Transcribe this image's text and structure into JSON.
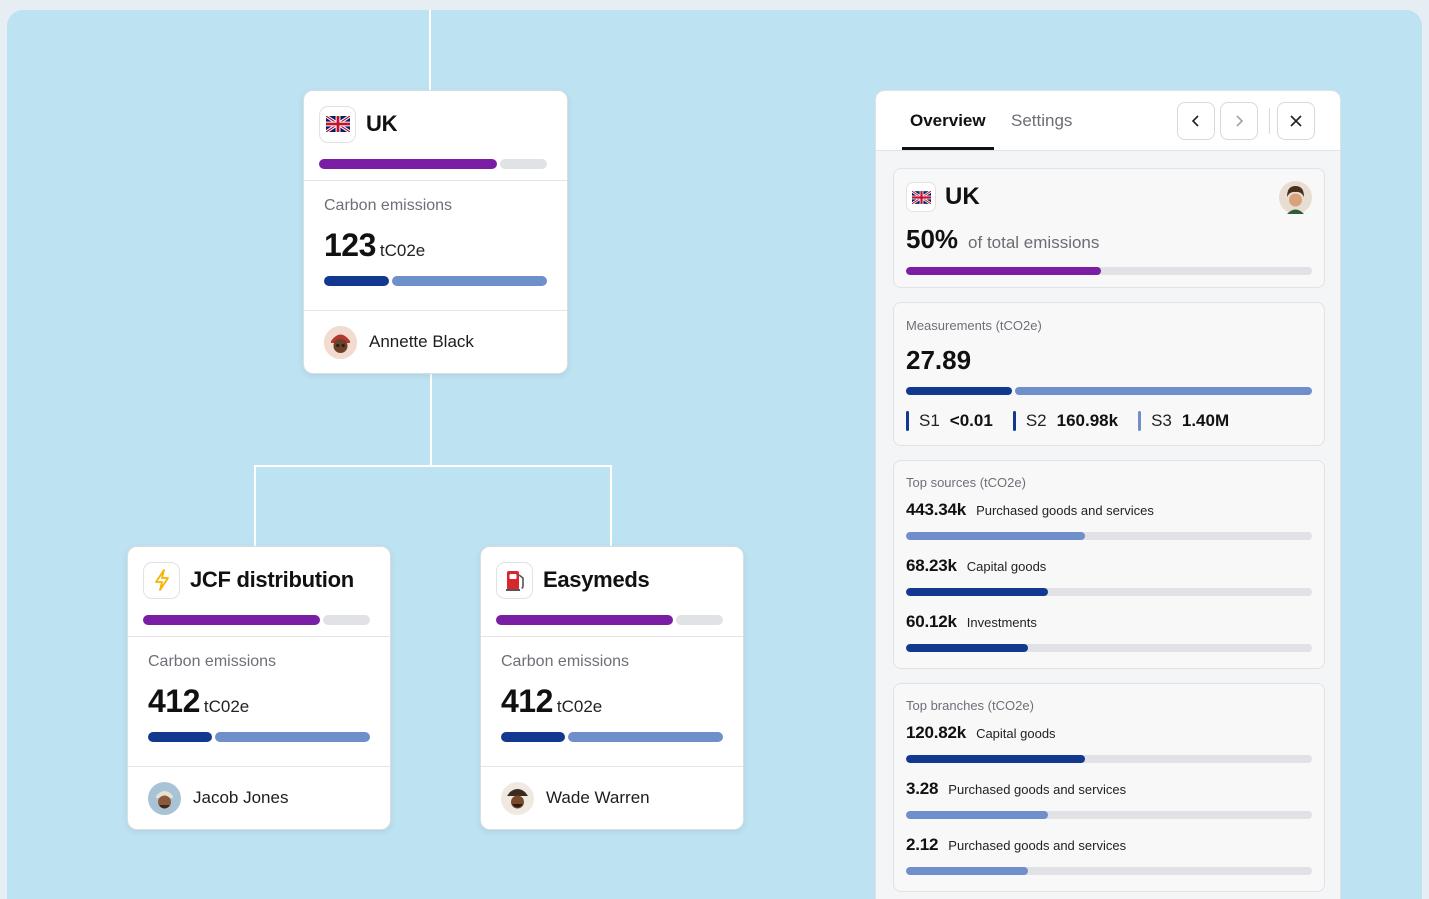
{
  "colors": {
    "background": "#bde3f2",
    "purple": "#7a1ea6",
    "navy": "#12388f",
    "lightBlue": "#6e8fc9",
    "grey": "#e1e2e5"
  },
  "nodes": [
    {
      "id": "uk",
      "title": "UK",
      "icon": "uk-flag-icon",
      "share": 0.78,
      "label": "Carbon emissions",
      "value": "123",
      "unit": "tC02e",
      "split": 0.29,
      "person": "Annette Black",
      "avatar": "avatar-annette-icon"
    },
    {
      "id": "jcf",
      "title": "JCF distribution",
      "icon": "lightning-icon",
      "share": 0.78,
      "label": "Carbon emissions",
      "value": "412",
      "unit": "tC02e",
      "split": 0.29,
      "person": "Jacob Jones",
      "avatar": "avatar-jacob-icon"
    },
    {
      "id": "easymeds",
      "title": "Easymeds",
      "icon": "fuel-pump-icon",
      "share": 0.78,
      "label": "Carbon emissions",
      "value": "412",
      "unit": "tC02e",
      "split": 0.29,
      "person": "Wade Warren",
      "avatar": "avatar-wade-icon"
    }
  ],
  "panel": {
    "tabs": [
      "Overview",
      "Settings"
    ],
    "summary": {
      "title": "UK",
      "percent": "50%",
      "percent_label": "of total emissions",
      "share": 0.48
    },
    "measurements": {
      "title": "Measurements (tCO2e)",
      "value": "27.89",
      "split": 0.26,
      "scopes": [
        {
          "label": "S1",
          "value": "<0.01",
          "color": "#12388f"
        },
        {
          "label": "S2",
          "value": "160.98k",
          "color": "#12388f"
        },
        {
          "label": "S3",
          "value": "1.40M",
          "color": "#6e8fc9"
        }
      ]
    },
    "top_sources": {
      "title": "Top sources (tCO2e)",
      "items": [
        {
          "value": "443.34k",
          "label": "Purchased goods and services",
          "fraction": 0.44,
          "color": "#6e8fc9"
        },
        {
          "value": "68.23k",
          "label": "Capital goods",
          "fraction": 0.35,
          "color": "#12388f"
        },
        {
          "value": "60.12k",
          "label": "Investments",
          "fraction": 0.3,
          "color": "#12388f"
        }
      ]
    },
    "top_branches": {
      "title": "Top branches (tCO2e)",
      "items": [
        {
          "value": "120.82k",
          "label": "Capital goods",
          "fraction": 0.44,
          "color": "#12388f"
        },
        {
          "value": "3.28",
          "label": "Purchased goods and services",
          "fraction": 0.35,
          "color": "#6e8fc9"
        },
        {
          "value": "2.12",
          "label": "Purchased goods and services",
          "fraction": 0.3,
          "color": "#6e8fc9"
        }
      ]
    }
  }
}
